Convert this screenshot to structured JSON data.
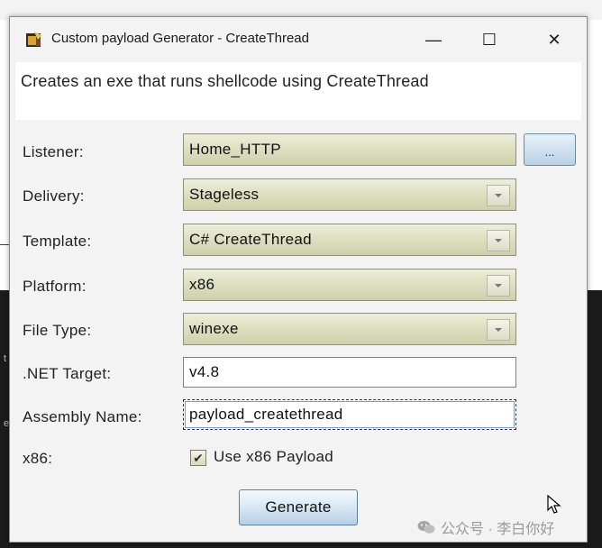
{
  "window": {
    "title": "Custom payload Generator - CreateThread",
    "minimize": "—",
    "maximize": "☐",
    "close": "✕"
  },
  "description": "Creates an exe that runs shellcode using CreateThread",
  "form": {
    "listener": {
      "label": "Listener:",
      "value": "Home_HTTP",
      "browse_label": "..."
    },
    "delivery": {
      "label": "Delivery:",
      "value": "Stageless"
    },
    "template": {
      "label": "Template:",
      "value": "C# CreateThread"
    },
    "platform": {
      "label": "Platform:",
      "value": "x86"
    },
    "file_type": {
      "label": "File Type:",
      "value": "winexe"
    },
    "net_target": {
      "label": ".NET Target:",
      "value": "v4.8"
    },
    "assembly_name": {
      "label": "Assembly Name:",
      "value": "payload_createthread"
    },
    "x86": {
      "label": "x86:",
      "checkbox_label": "Use x86 Payload",
      "checked": true
    }
  },
  "generate_label": "Generate",
  "watermark": "公众号 · 李白你好",
  "background_chars": [
    "t",
    "e"
  ],
  "icons": {
    "app": "payload-app-icon",
    "dropdown": "chevron-down-icon",
    "check": "checkmark-icon",
    "watermark": "wechat-icon",
    "cursor": "mouse-pointer-icon"
  }
}
